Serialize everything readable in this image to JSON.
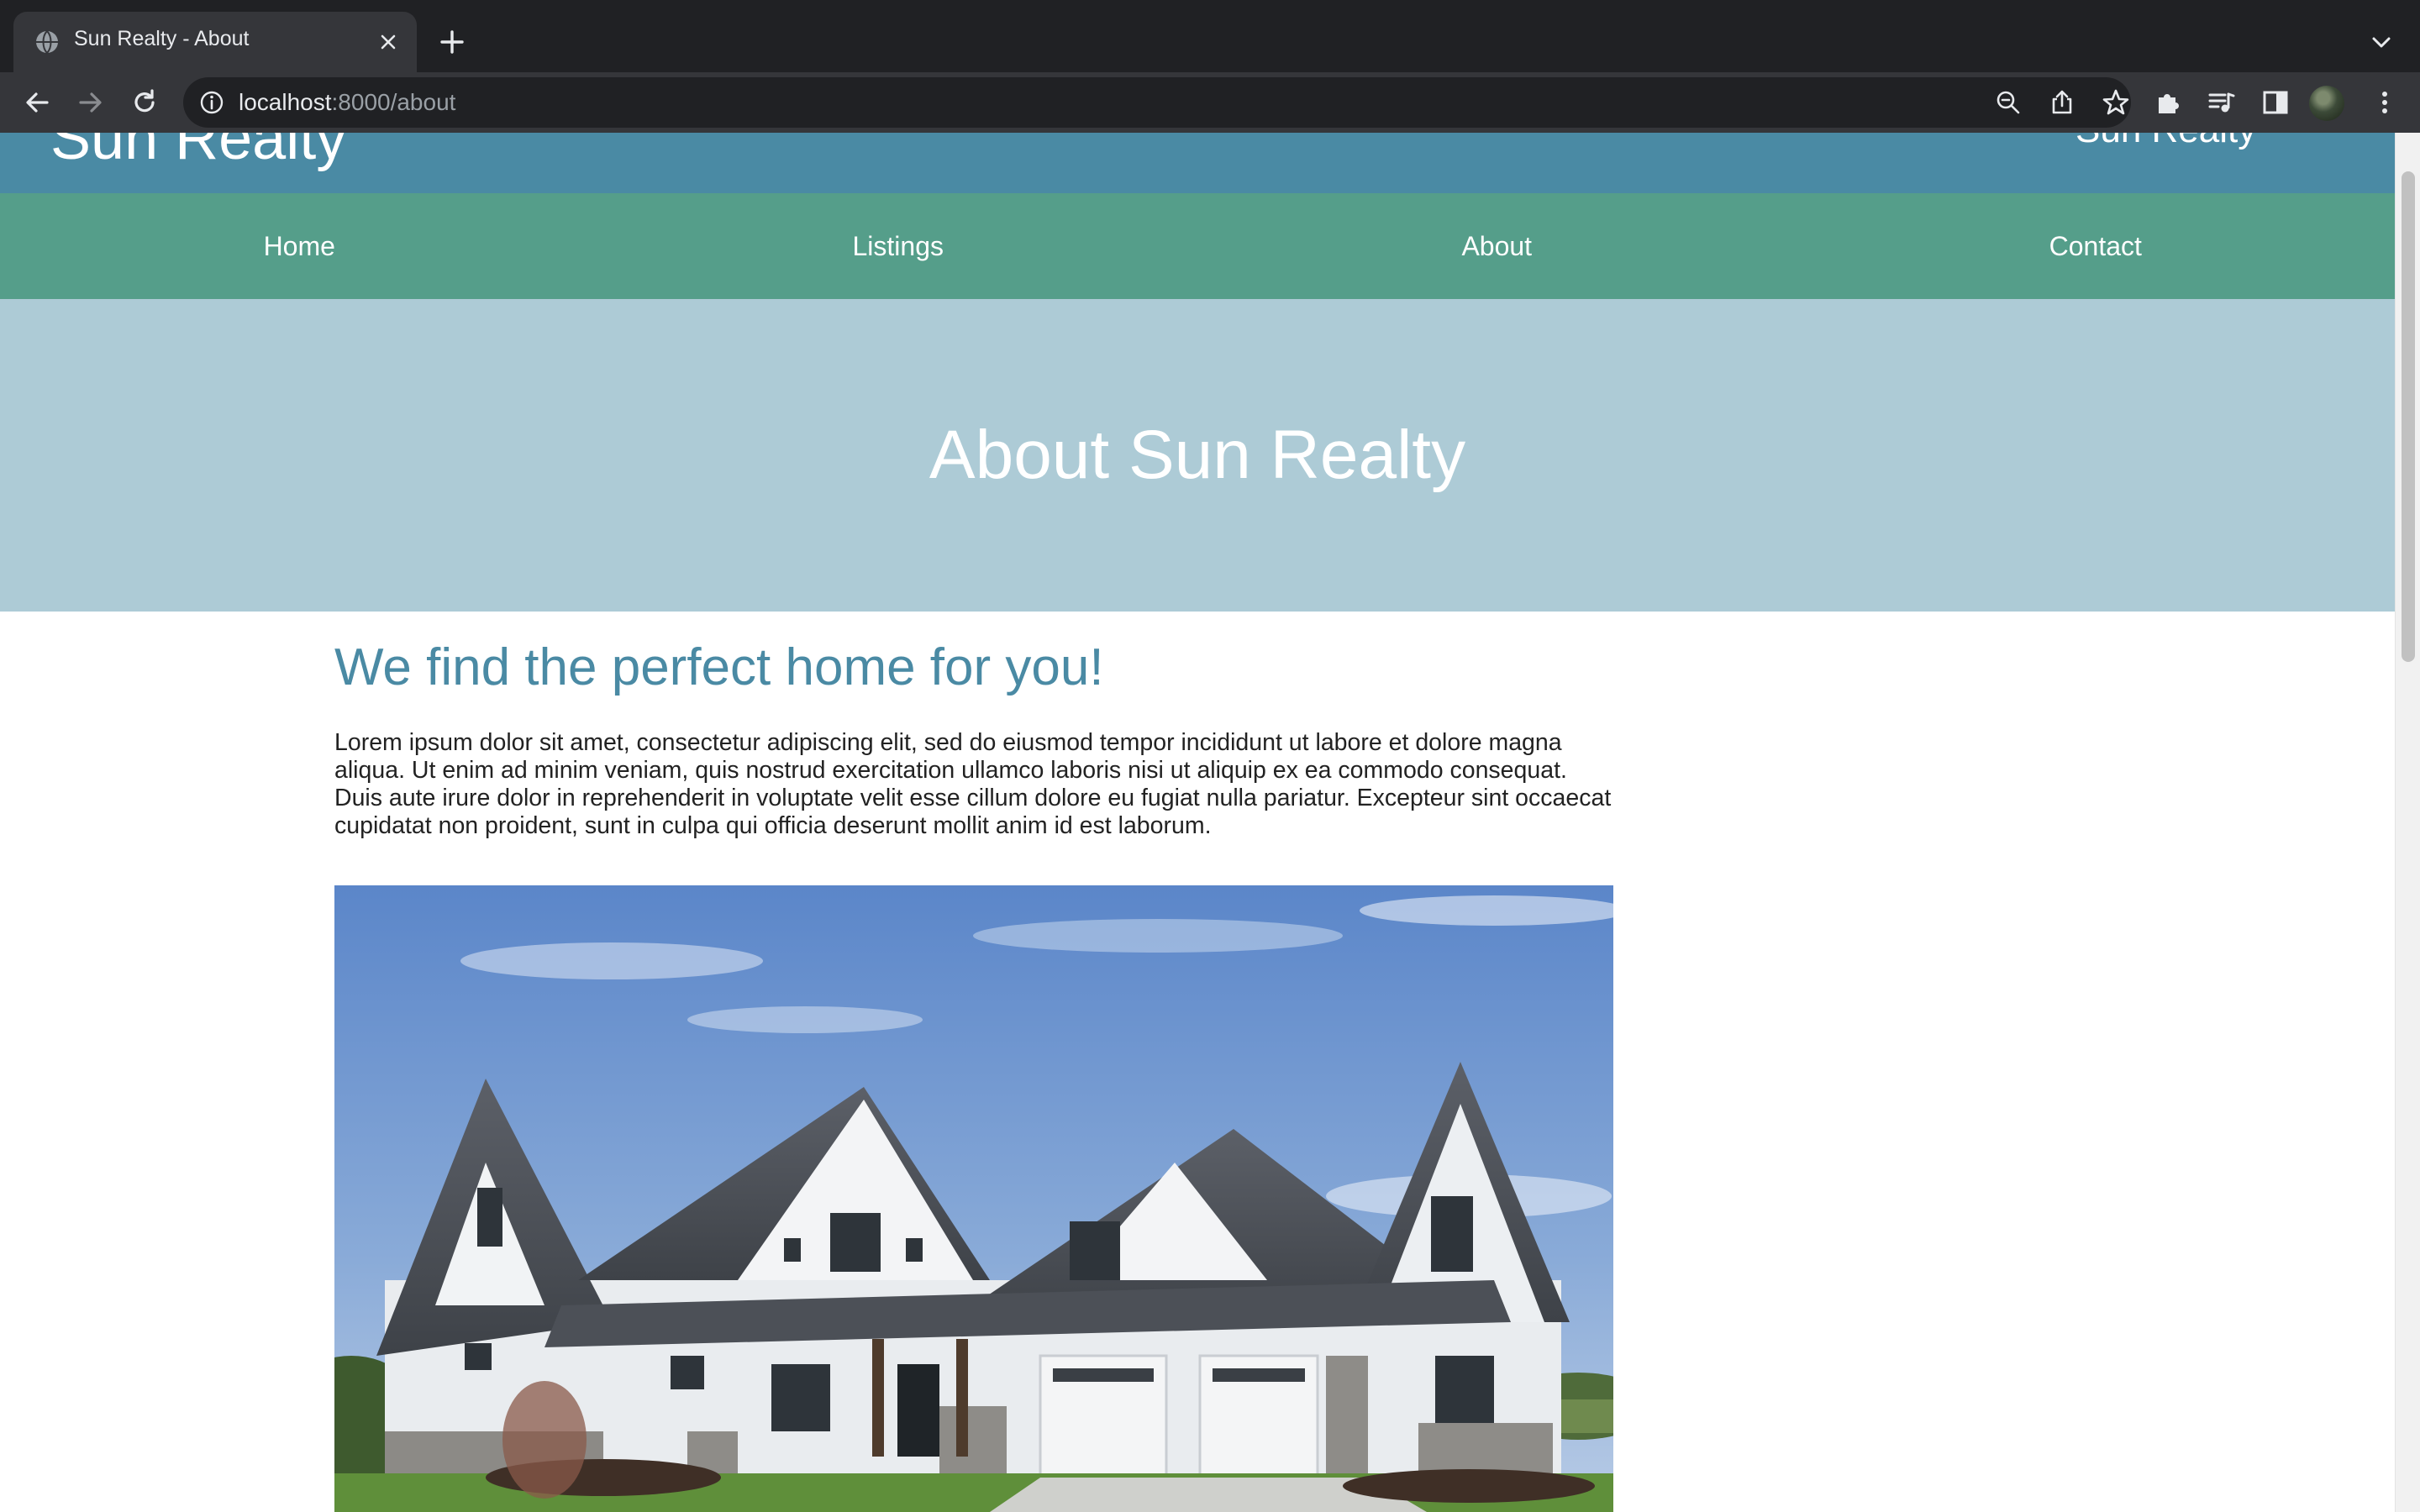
{
  "browser": {
    "tab_title": "Sun Realty - About",
    "url_host": "localhost",
    "url_path": ":8000/about"
  },
  "site": {
    "logo": "Sun Realty",
    "tagline": "Sun Realty",
    "nav": [
      "Home",
      "Listings",
      "About",
      "Contact"
    ]
  },
  "hero": {
    "title": "About Sun Realty"
  },
  "main": {
    "heading": "We find the perfect home for you!",
    "body": "Lorem ipsum dolor sit amet, consectetur adipiscing elit, sed do eiusmod tempor incididunt ut labore et dolore magna aliqua. Ut enim ad minim veniam, quis nostrud exercitation ullamco laboris nisi ut aliquip ex ea commodo consequat. Duis aute irure dolor in reprehenderit in voluptate velit esse cillum dolore eu fugiat nulla pariatur. Excepteur sint occaecat cupidatat non proident, sunt in culpa qui officia deserunt mollit anim id est laborum."
  },
  "icons": [
    "globe-icon",
    "close-icon",
    "plus-icon",
    "chevron-down-icon",
    "back-arrow-icon",
    "forward-arrow-icon",
    "reload-icon",
    "info-icon",
    "zoom-icon",
    "share-icon",
    "star-icon",
    "puzzle-icon",
    "media-icon",
    "side-panel-icon",
    "menu-dots-icon"
  ],
  "colors": {
    "header": "#4a8aa4",
    "nav": "#559e8a",
    "hero": "#adcbd6",
    "heading": "#4a8aa4"
  }
}
